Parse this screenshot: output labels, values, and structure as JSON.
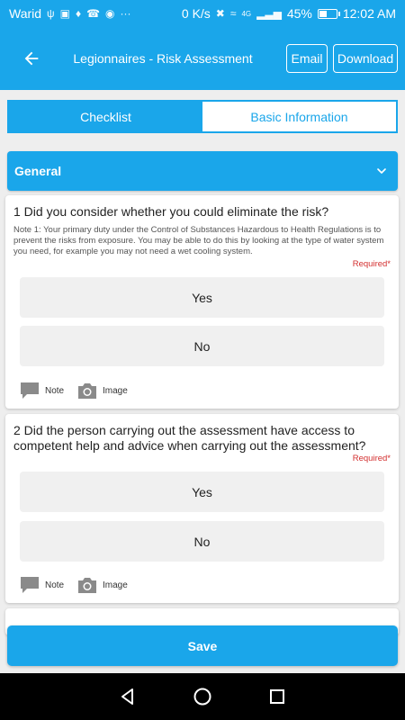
{
  "status_bar": {
    "carrier": "Warid",
    "network_speed": "0 K/s",
    "network_type": "4G",
    "battery": "45%",
    "battery_level": 0.45,
    "time": "12:02 AM"
  },
  "app_bar": {
    "title": "Legionnaires - Risk Assessment",
    "email_label": "Email",
    "download_label": "Download"
  },
  "tabs": [
    {
      "label": "Checklist",
      "active": true
    },
    {
      "label": "Basic Information",
      "active": false
    }
  ],
  "section": {
    "title": "General"
  },
  "questions": [
    {
      "title": "1 Did you consider whether you could eliminate the risk?",
      "note": "Note 1: Your primary duty under the Control of Substances Hazardous to Health Regulations is to prevent the risks from exposure. You may be able to do this by looking at the type of water system you need, for example you may not need a wet cooling system.",
      "required": "Required*",
      "options": [
        "Yes",
        "No"
      ],
      "note_label": "Note",
      "image_label": "Image"
    },
    {
      "title": "2 Did the person carrying out the assessment have access to competent help and advice when carrying out the assessment?",
      "required": "Required*",
      "options": [
        "Yes",
        "No"
      ],
      "note_label": "Note",
      "image_label": "Image"
    }
  ],
  "save_label": "Save",
  "colors": {
    "primary": "#1aa6ea",
    "required": "#d32f2f",
    "option_bg": "#f0f0f0"
  }
}
